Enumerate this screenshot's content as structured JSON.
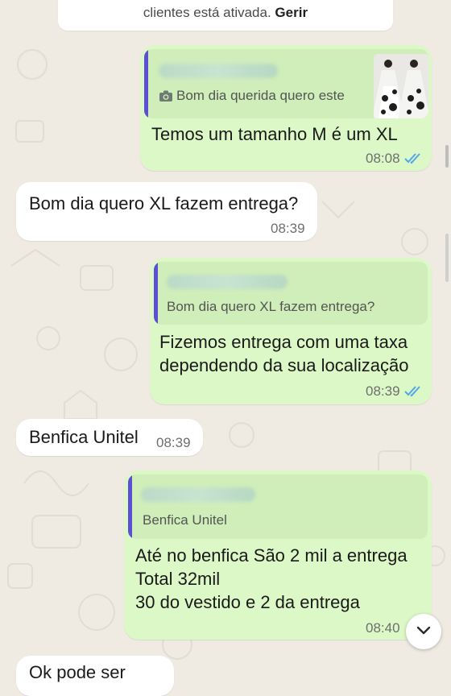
{
  "system_notice": {
    "line1": "…",
    "line2_prefix": "clientes está ativada.",
    "line2_link": "Gerir"
  },
  "messages": [
    {
      "direction": "outgoing",
      "quoted_text": "Bom dia querida quero este",
      "text": "Temos um tamanho M é um XL",
      "time": "08:08",
      "status": "read"
    },
    {
      "direction": "incoming",
      "text": "Bom dia quero XL fazem entrega?",
      "time": "08:39"
    },
    {
      "direction": "outgoing",
      "quoted_text": "Bom dia quero XL fazem entrega?",
      "text": "Fizemos entrega com uma taxa\ndependendo da sua localização",
      "time": "08:39",
      "status": "read"
    },
    {
      "direction": "incoming",
      "text": "Benfica Unitel",
      "time": "08:39"
    },
    {
      "direction": "outgoing",
      "quoted_text": "Benfica Unitel",
      "text": "Até no benfica São 2 mil a entrega\nTotal 32mil\n30 do vestido e 2 da entrega",
      "time": "08:40"
    },
    {
      "direction": "incoming",
      "text": "Ok pode ser",
      "time": ""
    }
  ],
  "colors": {
    "outgoing_bubble": "#dcf8c6",
    "incoming_bubble": "#ffffff",
    "read_ticks": "#53a6e8",
    "quote_bar": "#5b4fd6",
    "background": "#efeae2"
  },
  "icons": {
    "quoted_media": "camera-icon",
    "status": "double-check-icon",
    "scroll": "chevron-down-icon"
  }
}
